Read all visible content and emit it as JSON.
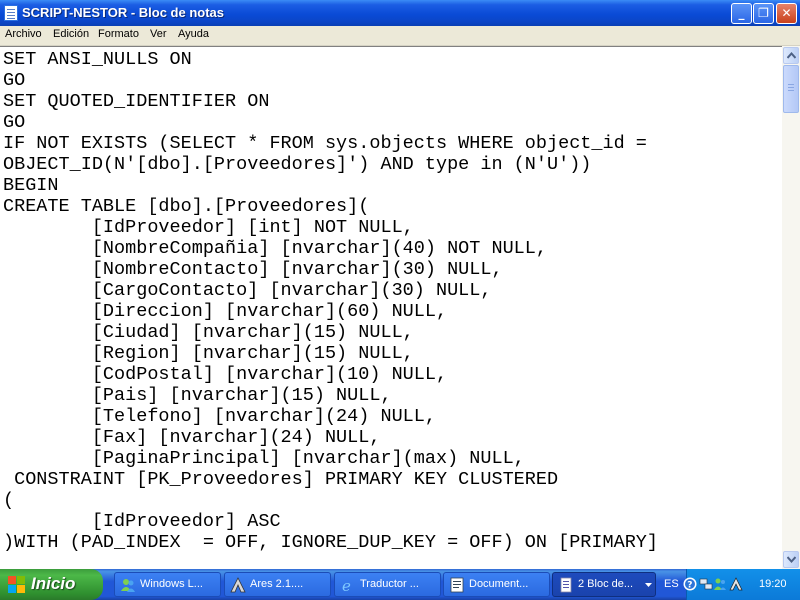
{
  "window": {
    "title": "SCRIPT-NESTOR - Bloc de notas",
    "controls": {
      "minimize": "_",
      "maximize": "❐",
      "close": "✕"
    }
  },
  "menu": [
    "Archivo",
    "Edición",
    "Formato",
    "Ver",
    "Ayuda"
  ],
  "editor": {
    "lines": [
      "SET ANSI_NULLS ON",
      "GO",
      "SET QUOTED_IDENTIFIER ON",
      "GO",
      "IF NOT EXISTS (SELECT * FROM sys.objects WHERE object_id =",
      "OBJECT_ID(N'[dbo].[Proveedores]') AND type in (N'U'))",
      "BEGIN",
      "CREATE TABLE [dbo].[Proveedores](",
      "\t[IdProveedor] [int] NOT NULL,",
      "\t[NombreCompañia] [nvarchar](40) NOT NULL,",
      "\t[NombreContacto] [nvarchar](30) NULL,",
      "\t[CargoContacto] [nvarchar](30) NULL,",
      "\t[Direccion] [nvarchar](60) NULL,",
      "\t[Ciudad] [nvarchar](15) NULL,",
      "\t[Region] [nvarchar](15) NULL,",
      "\t[CodPostal] [nvarchar](10) NULL,",
      "\t[Pais] [nvarchar](15) NULL,",
      "\t[Telefono] [nvarchar](24) NULL,",
      "\t[Fax] [nvarchar](24) NULL,",
      "\t[PaginaPrincipal] [nvarchar](max) NULL,",
      " CONSTRAINT [PK_Proveedores] PRIMARY KEY CLUSTERED",
      "(",
      "\t[IdProveedor] ASC",
      ")WITH (PAD_INDEX  = OFF, IGNORE_DUP_KEY = OFF) ON [PRIMARY]"
    ]
  },
  "taskbar": {
    "start_label": "Inicio",
    "tasks": [
      {
        "label": "Windows L...",
        "icon": "messenger-icon"
      },
      {
        "label": "Ares 2.1....",
        "icon": "ares-icon"
      },
      {
        "label": "Traductor ...",
        "icon": "browser-icon"
      },
      {
        "label": "Document...",
        "icon": "document-icon"
      },
      {
        "label": "2 Bloc de...",
        "icon": "notepad-icon",
        "active": true
      }
    ],
    "language": "ES",
    "clock": "19:20"
  },
  "colors": {
    "titlebar": "#0A4BD6",
    "taskbar": "#2157D7",
    "start_button": "#3C9C3C",
    "tray": "#0C7AD8",
    "menu_bg": "#ECE9D8"
  }
}
